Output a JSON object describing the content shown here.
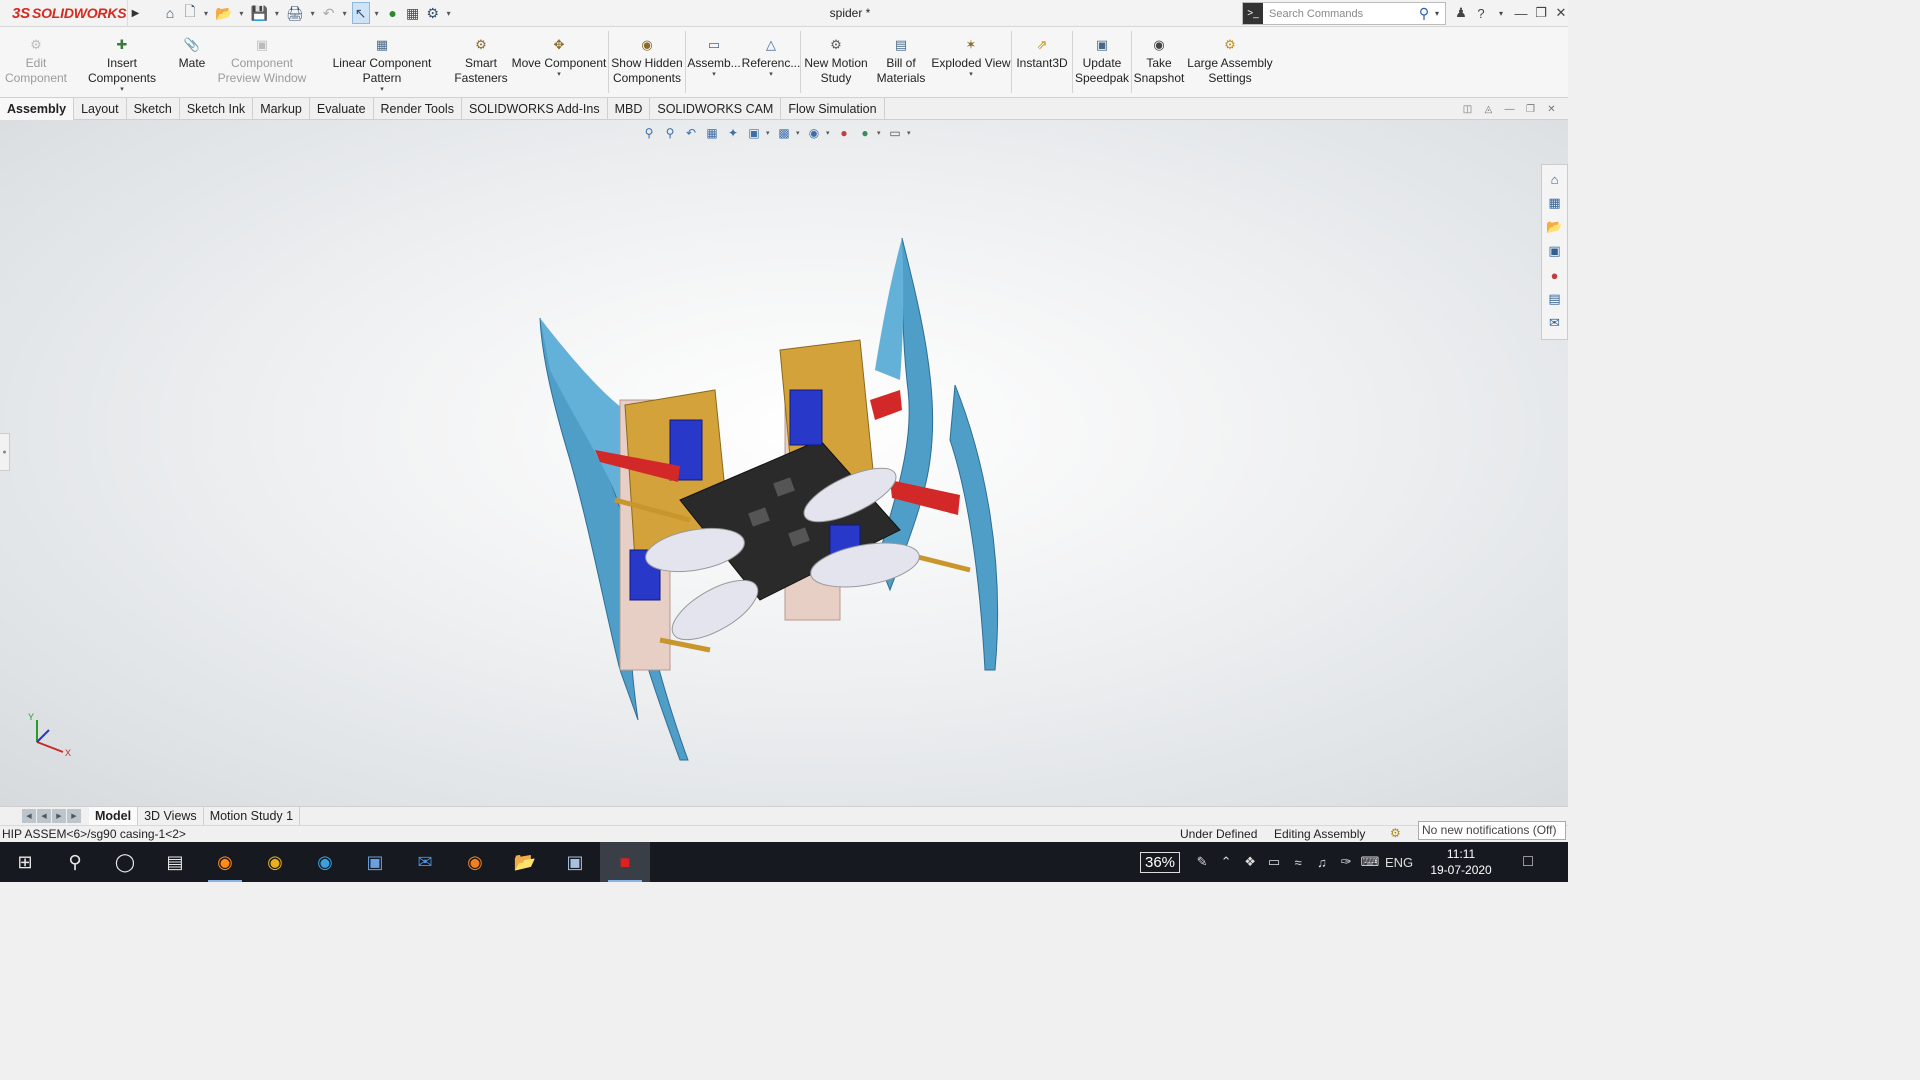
{
  "app": {
    "brand_ds": "3S",
    "brand_name": "SOLIDWORKS",
    "doc_title": "spider *"
  },
  "search": {
    "placeholder": "Search Commands"
  },
  "ribbon": [
    {
      "label": "Edit\nComponent",
      "disabled": true,
      "icon": "edit-component-icon"
    },
    {
      "label": "Insert Components",
      "icon": "insert-components-icon",
      "dropdown": true
    },
    {
      "label": "Mate",
      "icon": "mate-icon"
    },
    {
      "label": "Component\nPreview Window",
      "disabled": true,
      "icon": "preview-window-icon"
    },
    {
      "label": "Linear Component Pattern",
      "icon": "linear-pattern-icon",
      "dropdown": true
    },
    {
      "label": "Smart\nFasteners",
      "icon": "smart-fasteners-icon"
    },
    {
      "label": "Move Component",
      "icon": "move-component-icon",
      "dropdown": true
    },
    {
      "label": "Show Hidden\nComponents",
      "icon": "show-hidden-icon"
    },
    {
      "label": "Assemb...",
      "icon": "assembly-features-icon",
      "dropdown": true
    },
    {
      "label": "Referenc...",
      "icon": "reference-geometry-icon",
      "dropdown": true
    },
    {
      "label": "New Motion\nStudy",
      "icon": "motion-study-icon"
    },
    {
      "label": "Bill of\nMaterials",
      "icon": "bom-icon"
    },
    {
      "label": "Exploded View",
      "icon": "exploded-view-icon",
      "dropdown": true
    },
    {
      "label": "Instant3D",
      "icon": "instant3d-icon"
    },
    {
      "label": "Update\nSpeedpak",
      "icon": "speedpak-icon"
    },
    {
      "label": "Take\nSnapshot",
      "icon": "snapshot-icon"
    },
    {
      "label": "Large Assembly\nSettings",
      "icon": "large-assembly-icon"
    }
  ],
  "tabs": [
    "Assembly",
    "Layout",
    "Sketch",
    "Sketch Ink",
    "Markup",
    "Evaluate",
    "Render Tools",
    "SOLIDWORKS Add-Ins",
    "MBD",
    "SOLIDWORKS CAM",
    "Flow Simulation"
  ],
  "bottom_tabs": [
    "Model",
    "3D Views",
    "Motion Study 1"
  ],
  "status": {
    "selection": "HIP ASSEM<6>/sg90 casing-1<2>",
    "definition": "Under Defined",
    "mode": "Editing Assembly",
    "notifications": "No new notifications (Off)"
  },
  "taskbar": {
    "battery": "36%",
    "lang": "ENG",
    "time": "11:11",
    "date": "19-07-2020"
  },
  "triad": {
    "y": "Y",
    "x": "X"
  },
  "colors": {
    "brand": "#d62a1e",
    "blade": "#4f9ec8",
    "accent": "#2a62a8"
  }
}
